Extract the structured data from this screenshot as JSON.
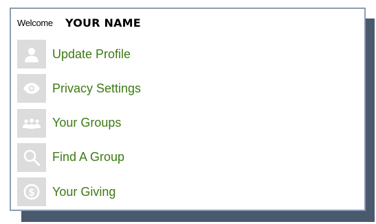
{
  "header": {
    "welcome_text": "Welcome",
    "user_name": "YOUR NAME"
  },
  "menu": {
    "items": [
      {
        "label": "Update Profile",
        "icon": "user-icon"
      },
      {
        "label": "Privacy Settings",
        "icon": "eye-icon"
      },
      {
        "label": "Your Groups",
        "icon": "group-icon"
      },
      {
        "label": "Find A Group",
        "icon": "search-icon"
      },
      {
        "label": "Your Giving",
        "icon": "dollar-coin-icon"
      }
    ]
  },
  "colors": {
    "link_green": "#3c7a12",
    "icon_tile": "#dcdcdc",
    "icon_glyph": "#ffffff",
    "panel_border": "#8b9cb3",
    "shadow": "#4a5a6e"
  }
}
